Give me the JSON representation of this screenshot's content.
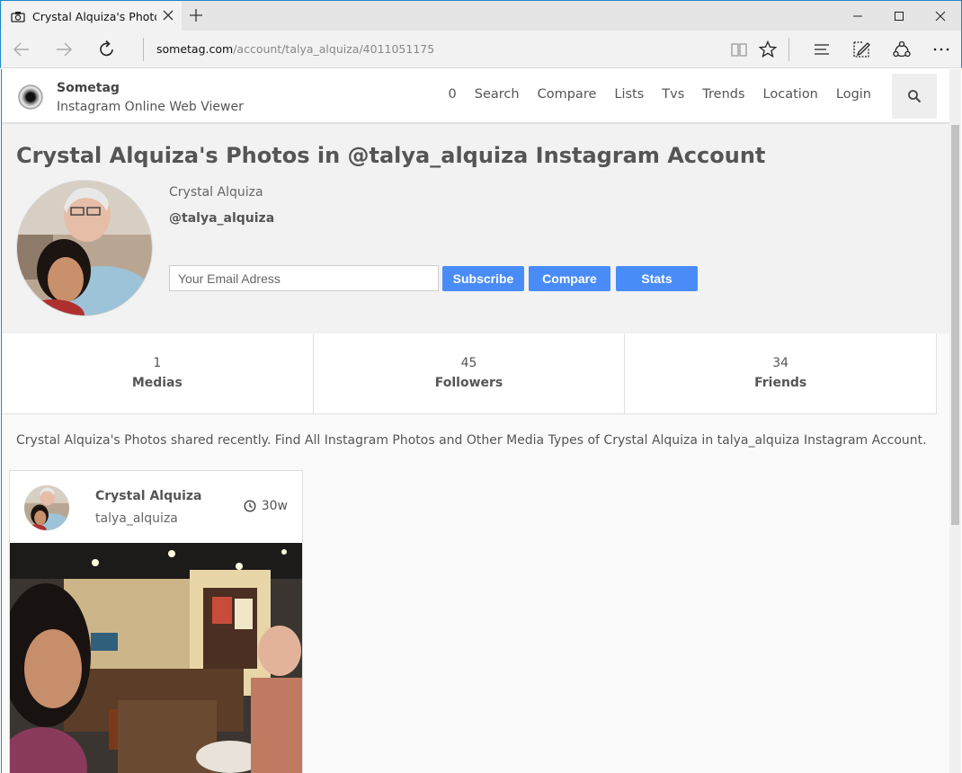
{
  "browser": {
    "tab_title": "Crystal Alquiza's Photos",
    "url_domain": "sometag.com",
    "url_path": "/account/talya_alquiza/4011051175"
  },
  "site": {
    "brand": "Sometag",
    "tagline": "Instagram Online Web Viewer",
    "menu": [
      "0",
      "Search",
      "Compare",
      "Lists",
      "Tvs",
      "Trends",
      "Location",
      "Login"
    ]
  },
  "profile": {
    "heading": "Crystal Alquiza's Photos in @talya_alquiza Instagram Account",
    "name": "Crystal Alquiza",
    "handle": "@talya_alquiza",
    "email_placeholder": "Your Email Adress",
    "subscribe_label": "Subscribe",
    "compare_label": "Compare",
    "stats_label": "Stats"
  },
  "stats": [
    {
      "value": "1",
      "label": "Medias"
    },
    {
      "value": "45",
      "label": "Followers"
    },
    {
      "value": "34",
      "label": "Friends"
    }
  ],
  "description": "Crystal Alquiza's Photos shared recently. Find All Instagram Photos and Other Media Types of Crystal Alquiza in talya_alquiza Instagram Account.",
  "post": {
    "name": "Crystal Alquiza",
    "handle": "talya_alquiza",
    "time": "30w"
  },
  "colors": {
    "accent": "#4a8cf7",
    "window_border": "#1e88c7"
  }
}
